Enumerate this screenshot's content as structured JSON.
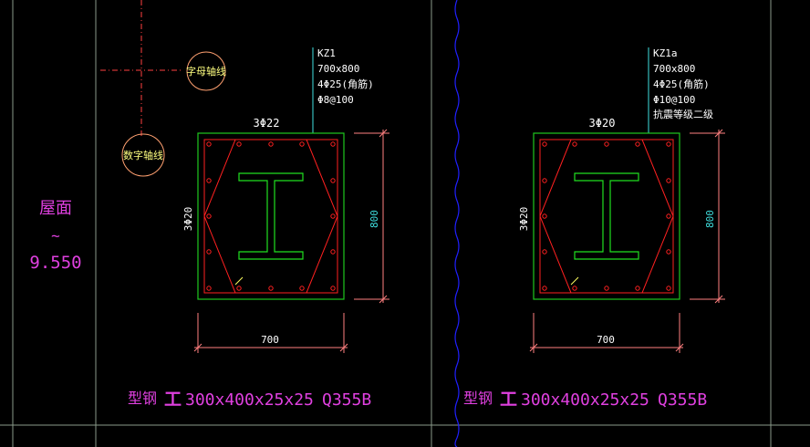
{
  "colors": {
    "background": "#000000",
    "frame": "#8a9a8a",
    "column_outline": "#1ec81e",
    "rebar": "#ff2020",
    "dimension_tick": "#ff8080",
    "text_cyan": "#40e0e0",
    "text_white": "#ffffff",
    "text_magenta": "#e040e0",
    "steel_section": "#20e020",
    "break_line": "#2020ff",
    "axis_dash": "#ff4040",
    "bubble": "#ffa070"
  },
  "left_label": {
    "level_text": "屋面",
    "tilde": "~",
    "elevation": "9.550"
  },
  "axis_bubbles": {
    "letter_axis": "字母轴线",
    "number_axis": "数字轴线"
  },
  "columns": [
    {
      "id": "KZ1",
      "spec_lines": [
        "KZ1",
        "700x800",
        "4Φ25(角筋)",
        "Φ8@100"
      ],
      "top_bars": "3Φ22",
      "side_bars": "3Φ20",
      "height_dim": "800",
      "width_dim": "700",
      "steel": {
        "prefix": "型钢",
        "symbol": "工",
        "size": "300x400x25x25",
        "grade": "Q355B"
      }
    },
    {
      "id": "KZ1a",
      "spec_lines": [
        "KZ1a",
        "700x800",
        "4Φ25(角筋)",
        "Φ10@100",
        "抗震等级二级"
      ],
      "top_bars": "3Φ20",
      "side_bars": "3Φ20",
      "height_dim": "800",
      "width_dim": "700",
      "steel": {
        "prefix": "型钢",
        "symbol": "工",
        "size": "300x400x25x25",
        "grade": "Q355B"
      }
    }
  ]
}
